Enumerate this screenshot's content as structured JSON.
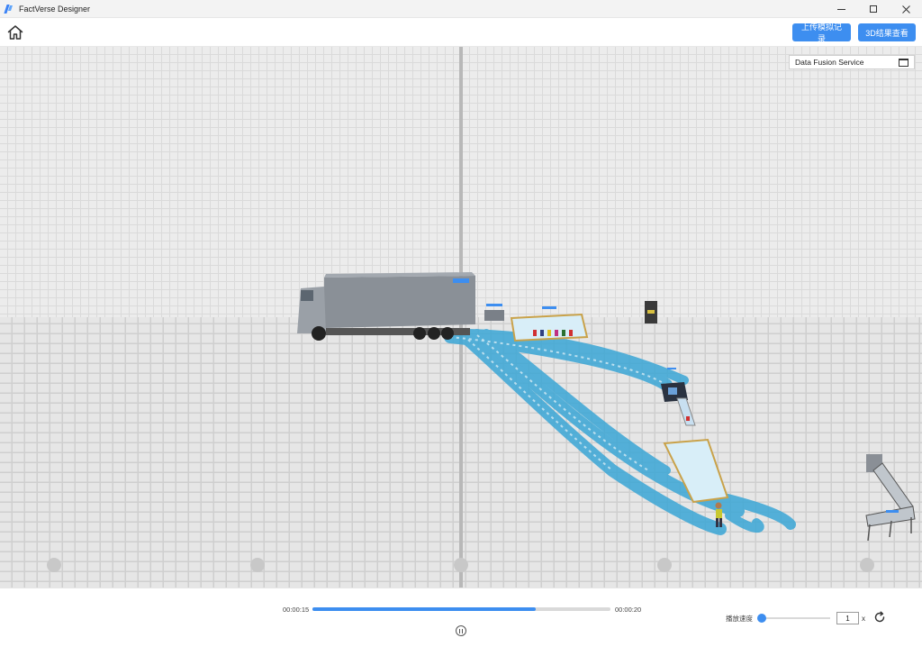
{
  "window": {
    "title": "FactVerse Designer",
    "icons": {
      "app": "factverse-logo-icon",
      "minimize": "minimize-icon",
      "maximize": "maximize-icon",
      "close": "close-icon"
    }
  },
  "toolbar": {
    "home_icon": "home-icon",
    "upload_label": "上传模拟记录",
    "view3d_label": "3D结果查看"
  },
  "panel": {
    "title": "Data Fusion Service",
    "icon": "window-icon"
  },
  "playback": {
    "current_time": "00:00:15",
    "total_time": "00:00:20",
    "progress": 0.75,
    "pause_icon": "pause-icon",
    "speed_label": "播放速度",
    "speed_value": "1",
    "speed_unit": "x",
    "reset_icon": "refresh-icon"
  },
  "colors": {
    "accent": "#3d8ef0",
    "floor": "#dcdcdc",
    "path": "#3aa6d6"
  }
}
